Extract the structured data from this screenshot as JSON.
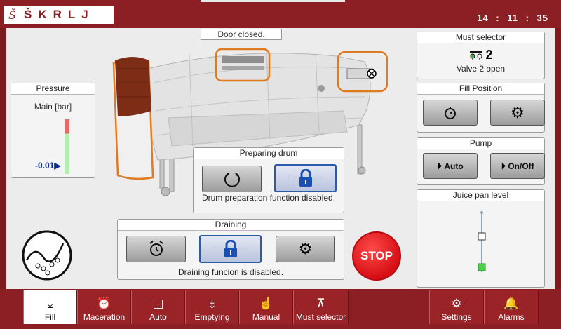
{
  "header": {
    "logo_mark": "Š",
    "logo_text": "ŠKRLJ",
    "clock": "14 : 11 : 35"
  },
  "status": {
    "door": "Door closed."
  },
  "pressure": {
    "title": "Pressure",
    "label": "Main [bar]",
    "value": "-0.01",
    "marker": "▶"
  },
  "must_selector": {
    "title": "Must selector",
    "valve_number": "2",
    "valve_text": "Valve 2 open",
    "icon": "valve-icon"
  },
  "fill_position": {
    "title": "Fill Position",
    "icons": [
      "timer-icon",
      "gears-icon"
    ]
  },
  "pump": {
    "title": "Pump",
    "auto_label": "Auto",
    "onoff_label": "On/Off"
  },
  "juice_pan": {
    "title": "Juice pan level"
  },
  "preparing_drum": {
    "title": "Preparing drum",
    "continue_label": "Continue",
    "info": "Drum preparation function disabled."
  },
  "draining": {
    "title": "Draining",
    "continue_label": "Continue",
    "info": "Draining funcion is disabled."
  },
  "stop_button": {
    "label": "STOP",
    "color": "#e0161c"
  },
  "tabs": [
    {
      "label": "Fill",
      "icon": "fill-icon",
      "active": true
    },
    {
      "label": "Maceration",
      "icon": "alarm-clock-icon"
    },
    {
      "label": "Auto",
      "icon": "auto-icon"
    },
    {
      "label": "Emptying",
      "icon": "emptying-icon"
    },
    {
      "label": "Manual",
      "icon": "hand-icon"
    },
    {
      "label": "Must selector",
      "icon": "valves-icon"
    },
    {
      "label": "Settings",
      "icon": "gears-icon"
    },
    {
      "label": "Alarms",
      "icon": "bell-icon"
    }
  ],
  "colors": {
    "brand": "#8c1f24",
    "accent_orange": "#e07a1f",
    "lock_blue": "#1a4fb4",
    "stop_red": "#e0161c"
  }
}
